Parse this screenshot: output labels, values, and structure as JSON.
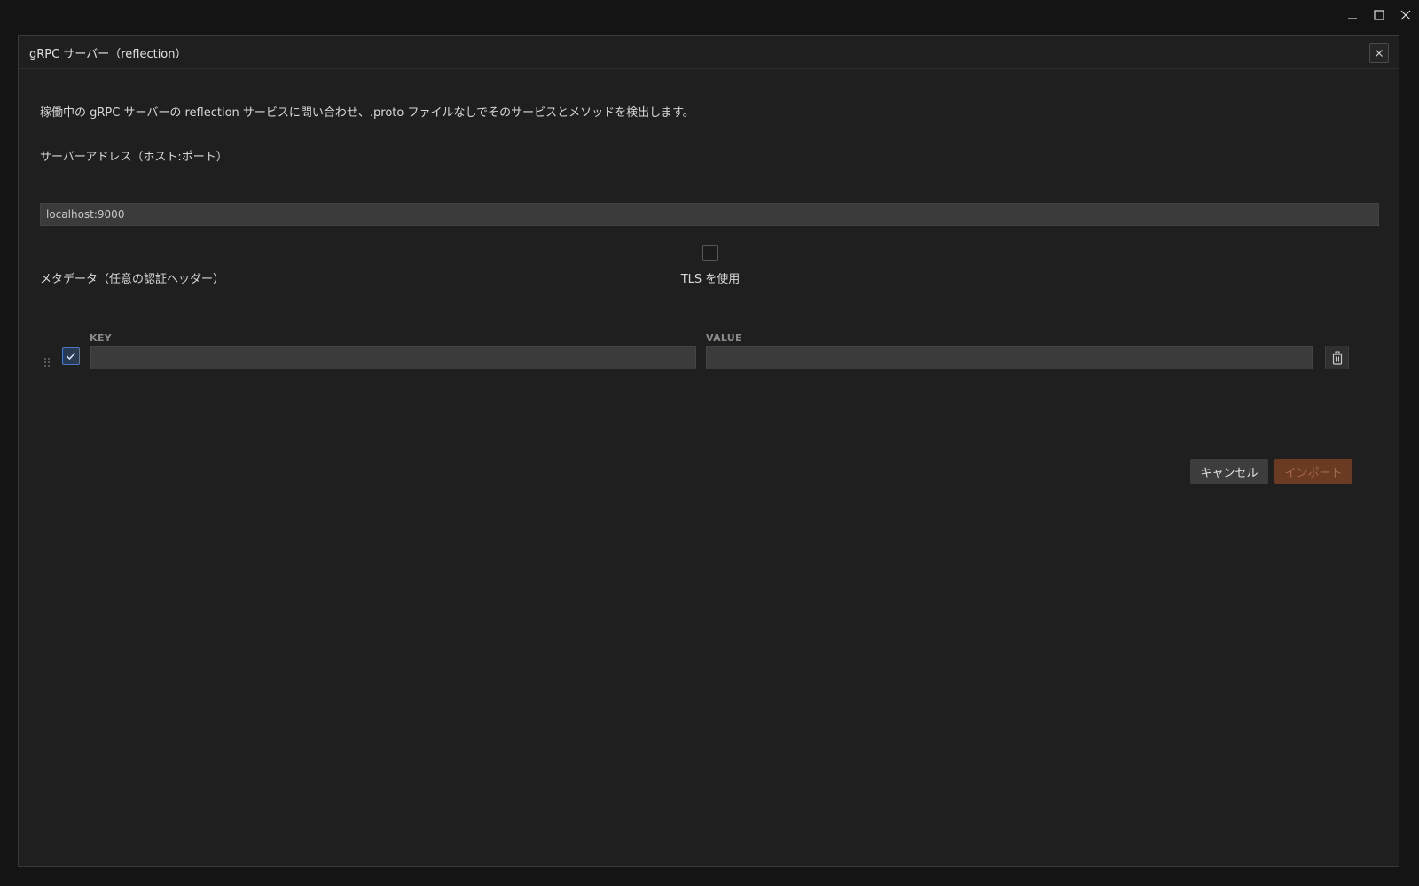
{
  "window": {
    "minimize_icon": "minimize-icon",
    "maximize_icon": "maximize-icon",
    "close_icon": "close-icon"
  },
  "dialog": {
    "title": "gRPC サーバー（reflection）",
    "description": "稼働中の gRPC サーバーの reflection サービスに問い合わせ、.proto ファイルなしでそのサービスとメソッドを検出します。",
    "address_label": "サーバーアドレス（ホスト:ポート）",
    "address_value": "localhost:9000",
    "tls_label": "TLS を使用",
    "tls_checked": false,
    "metadata_label": "メタデータ（任意の認証ヘッダー）",
    "metadata_columns": {
      "key": "KEY",
      "value": "VALUE"
    },
    "metadata_rows": [
      {
        "enabled": true,
        "key": "",
        "value": ""
      }
    ],
    "cancel_label": "キャンセル",
    "import_label": "インポート"
  },
  "colors": {
    "dialog_bg": "#1f1f1f",
    "input_bg": "#3b3b3b",
    "accent_import": "#6b3a22",
    "checkbox_accent": "#4a79c6"
  }
}
